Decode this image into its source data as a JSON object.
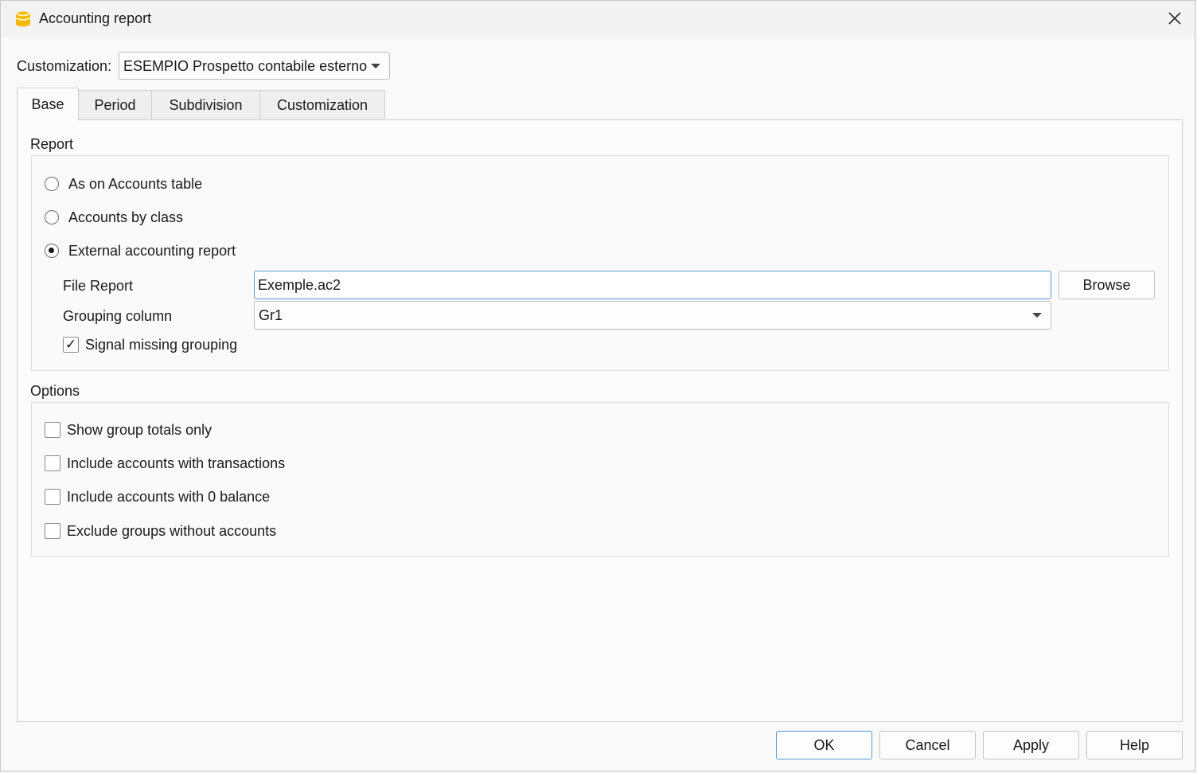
{
  "window": {
    "title": "Accounting report",
    "app_icon": "database-icon",
    "close_icon": "close-icon"
  },
  "customization": {
    "label": "Customization:",
    "selected": "ESEMPIO Prospetto contabile esterno"
  },
  "tabs": [
    {
      "label": "Base",
      "active": true
    },
    {
      "label": "Period",
      "active": false
    },
    {
      "label": "Subdivision",
      "active": false
    },
    {
      "label": "Customization",
      "active": false
    }
  ],
  "report": {
    "section_label": "Report",
    "options": [
      {
        "label": "As on Accounts table",
        "selected": false
      },
      {
        "label": "Accounts by class",
        "selected": false
      },
      {
        "label": "External accounting report",
        "selected": true
      }
    ],
    "file_report_label": "File Report",
    "file_report_value": "Exemple.ac2",
    "browse_label": "Browse",
    "grouping_label": "Grouping column",
    "grouping_value": "Gr1",
    "signal_missing_label": "Signal missing grouping",
    "signal_missing_checked": true,
    "check_mark": "✓"
  },
  "options": {
    "section_label": "Options",
    "items": [
      {
        "label": "Show group totals only",
        "checked": false
      },
      {
        "label": "Include accounts with transactions",
        "checked": false
      },
      {
        "label": "Include accounts with 0 balance",
        "checked": false
      },
      {
        "label": "Exclude groups without accounts",
        "checked": false
      }
    ]
  },
  "buttons": {
    "ok": "OK",
    "cancel": "Cancel",
    "apply": "Apply",
    "help": "Help"
  },
  "colors": {
    "focus_border": "#5b9bd5",
    "icon_yellow": "#f5b800"
  }
}
